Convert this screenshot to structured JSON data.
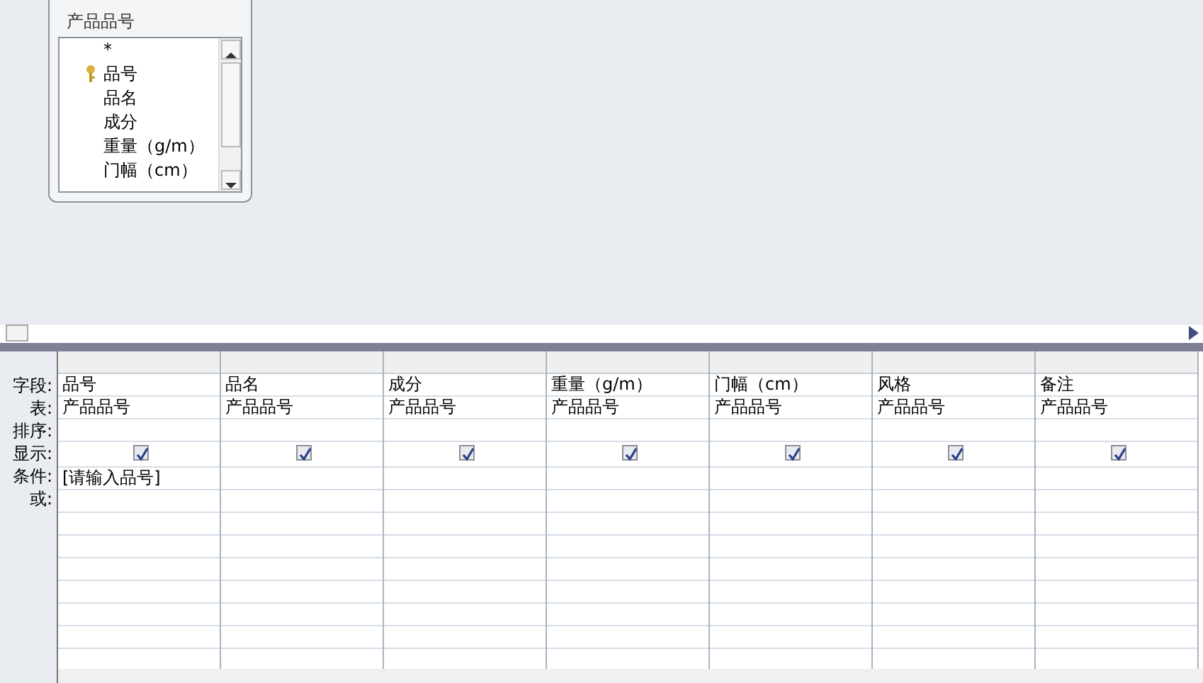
{
  "table_box": {
    "title": "产品品号",
    "fields": [
      {
        "name": "*",
        "primary_key": false
      },
      {
        "name": "品号",
        "primary_key": true
      },
      {
        "name": "品名",
        "primary_key": false
      },
      {
        "name": "成分",
        "primary_key": false
      },
      {
        "name": "重量（g/m）",
        "primary_key": false
      },
      {
        "name": "门幅（cm）",
        "primary_key": false
      }
    ]
  },
  "grid": {
    "row_labels": [
      "字段:",
      "表:",
      "排序:",
      "显示:",
      "条件:",
      "或:"
    ],
    "columns": [
      {
        "field": "品号",
        "table": "产品品号",
        "show": true,
        "criteria": "[请输入品号]"
      },
      {
        "field": "品名",
        "table": "产品品号",
        "show": true
      },
      {
        "field": "成分",
        "table": "产品品号",
        "show": true
      },
      {
        "field": "重量（g/m）",
        "table": "产品品号",
        "show": true
      },
      {
        "field": "门幅（cm）",
        "table": "产品品号",
        "show": true
      },
      {
        "field": "风格",
        "table": "产品品号",
        "show": true
      },
      {
        "field": "备注",
        "table": "产品品号",
        "show": true
      }
    ]
  }
}
